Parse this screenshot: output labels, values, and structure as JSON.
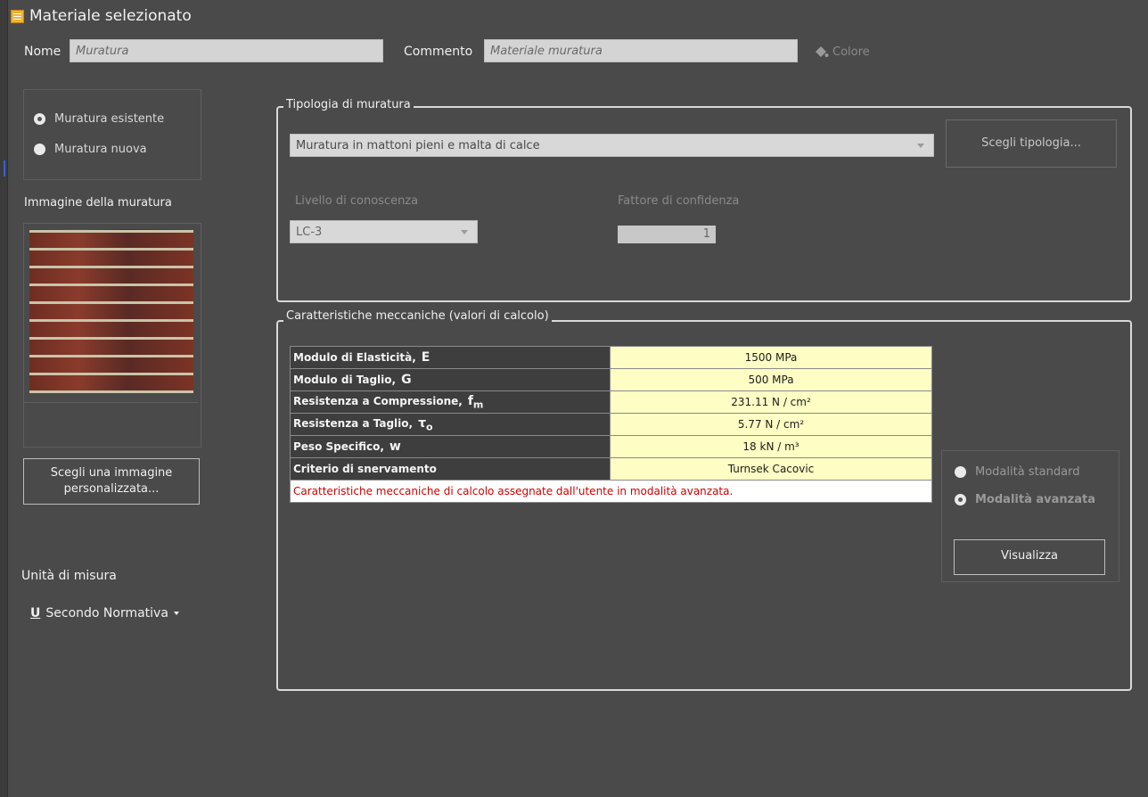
{
  "header": {
    "title": "Materiale selezionato",
    "name_label": "Nome",
    "name_value": "Muratura",
    "comment_label": "Commento",
    "comment_value": "Materiale muratura",
    "color_button": "Colore"
  },
  "left": {
    "radio_existing": "Muratura esistente",
    "radio_new": "Muratura nuova",
    "image_label": "Immagine della muratura",
    "choose_image_button": "Scegli una immagine personalizzata...",
    "units_label": "Unità di misura",
    "units_icon_letter": "U",
    "units_value": "Secondo Normativa"
  },
  "tipologia": {
    "legend": "Tipologia di muratura",
    "selected": "Muratura in mattoni pieni e malta di calce",
    "choose_button": "Scegli tipologia...",
    "knowledge_label": "Livello di conoscenza",
    "knowledge_value": "LC-3",
    "confidence_label": "Fattore di confidenza",
    "confidence_value": "1"
  },
  "mechanical": {
    "legend": "Caratteristiche meccaniche (valori di calcolo)",
    "rows": [
      {
        "name": "Modulo di Elasticità,",
        "symbol": "E",
        "sub": "",
        "value": "1500 MPa"
      },
      {
        "name": "Modulo di Taglio,",
        "symbol": "G",
        "sub": "",
        "value": "500 MPa"
      },
      {
        "name": "Resistenza a Compressione,",
        "symbol": "f",
        "sub": "m",
        "value": "231.11 N / cm²"
      },
      {
        "name": "Resistenza a Taglio,",
        "symbol": "τ",
        "sub": "o",
        "value": "5.77 N / cm²"
      },
      {
        "name": "Peso Specifico,",
        "symbol": "w",
        "sub": "",
        "value": "18 kN / m³"
      },
      {
        "name": "Criterio di snervamento",
        "symbol": "",
        "sub": "",
        "value": "Turnsek Cacovic"
      }
    ],
    "note": "Caratteristiche meccaniche di calcolo assegnate dall'utente in modalità avanzata.",
    "mode_standard": "Modalità standard",
    "mode_advanced": "Modalità avanzata",
    "view_button": "Visualizza"
  }
}
